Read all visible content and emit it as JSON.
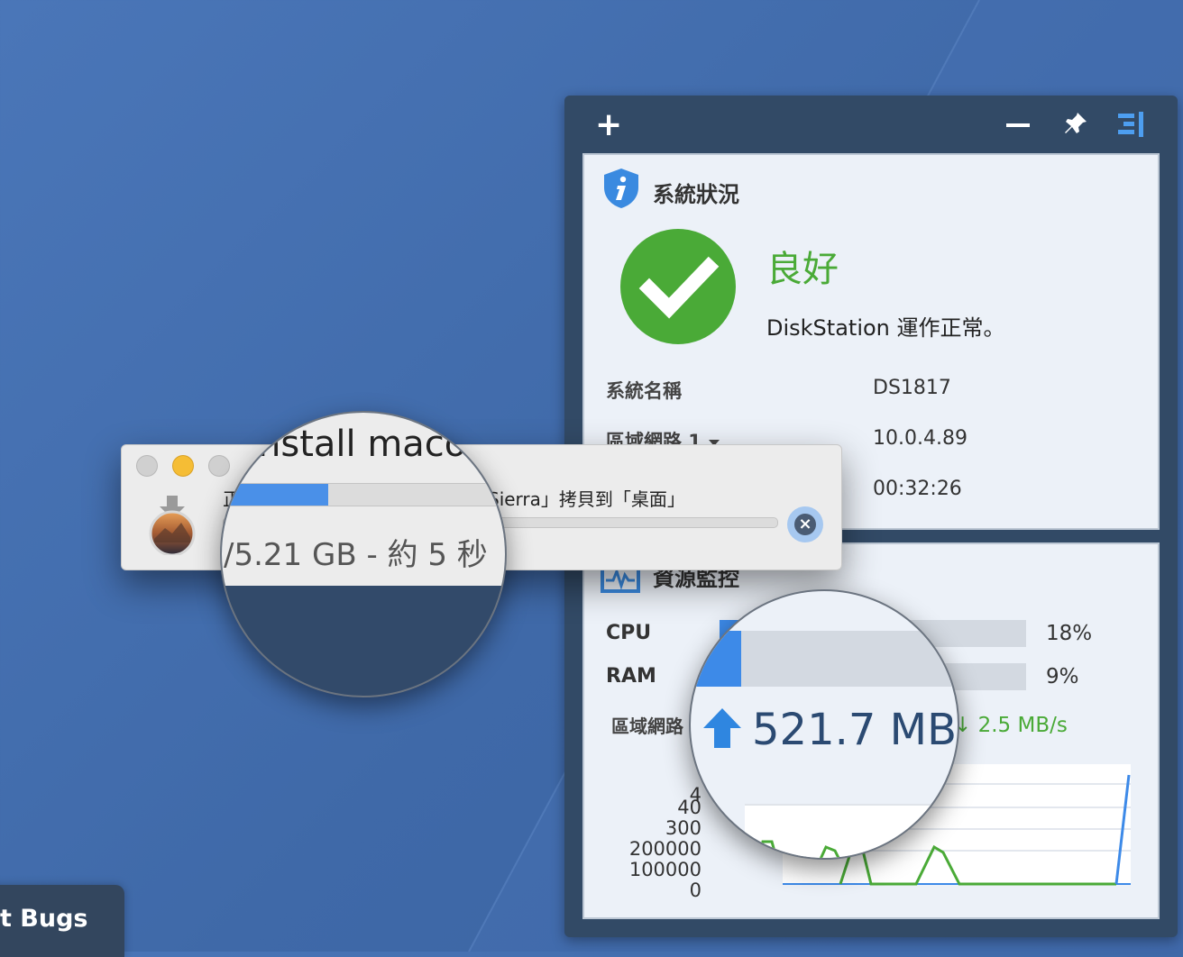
{
  "desktop": {
    "taskbar_chip_text": "t Bugs"
  },
  "widget": {
    "toolbar": {
      "add_icon": "plus-icon",
      "minimize_icon": "minus-icon",
      "pin_icon": "pin-icon",
      "dock_icon": "dock-right-icon"
    },
    "system_status": {
      "title": "系統狀況",
      "status": "良好",
      "message": "DiskStation 運作正常。",
      "rows": [
        {
          "label": "系統名稱",
          "value": "DS1817"
        },
        {
          "label": "區域網路 1",
          "value": "10.0.4.89"
        },
        {
          "label": "",
          "value": "00:32:26"
        }
      ]
    },
    "resource_monitor": {
      "title": "資源監控",
      "cpu_label": "CPU",
      "cpu_pct": "18%",
      "cpu_value": 0.18,
      "ram_label": "RAM",
      "ram_pct": "9%",
      "ram_value": 0.09,
      "network_label": "區域網路",
      "download_speed": "2.5 MB/s",
      "upload_total": "521.7 MB",
      "y_ticks": [
        "4",
        "40",
        "300",
        "200000",
        "100000",
        "0"
      ]
    },
    "colors": {
      "accent_blue": "#3d8ae8",
      "ok_green": "#4aaa37",
      "panel_dark": "#324a66"
    }
  },
  "copy_dialog": {
    "text_start": "正",
    "text_end": "Sierra」拷貝到「桌面」",
    "progress_value": 0.2,
    "magnified_title": "nstall maco",
    "magnified_subtitle": "/5.21 GB - 約 5 秒",
    "cancel_icon": "cancel-x-icon"
  }
}
